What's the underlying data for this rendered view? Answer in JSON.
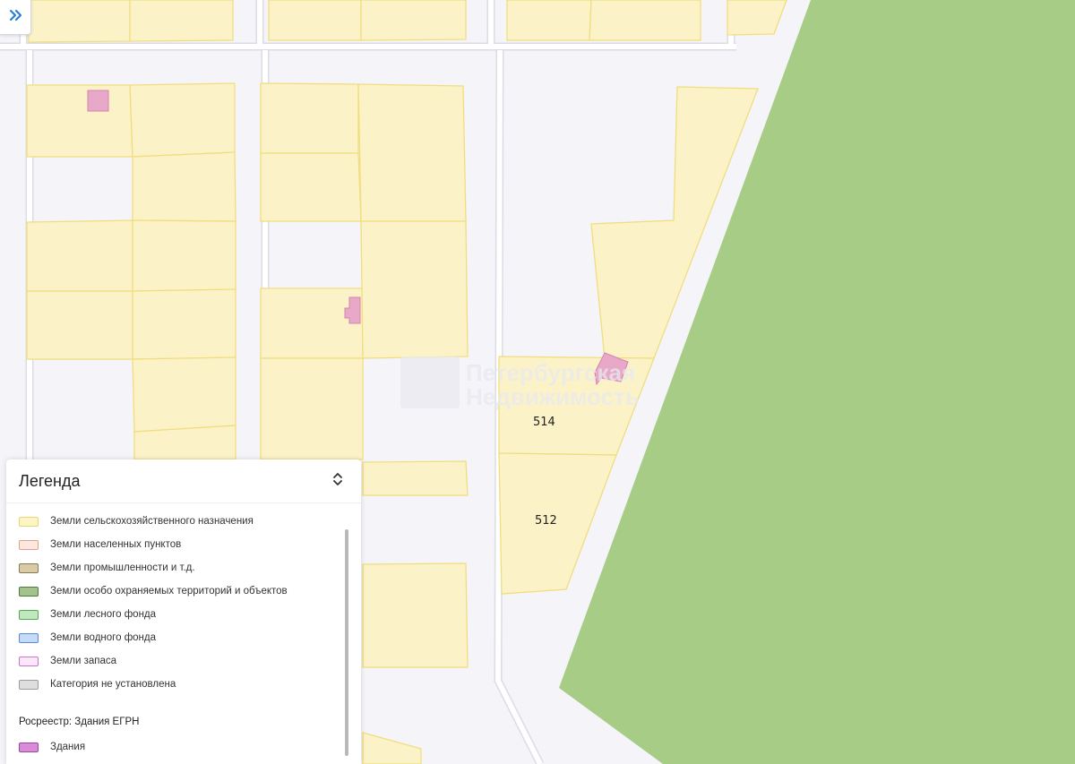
{
  "map": {
    "parcel_labels": [
      "514",
      "512"
    ],
    "watermark": {
      "line1": "Петербургская",
      "line2": "Недвижимость"
    },
    "colors": {
      "parcel_fill": "#fcf2c7",
      "parcel_stroke": "#f0de7e",
      "forest": "#a7cc86",
      "building": "#e8a8c8",
      "road": "#ffffff",
      "background": "#f4f4f9"
    }
  },
  "controls": {
    "expand_icon": "double-chevron-right-icon"
  },
  "legend": {
    "title": "Легенда",
    "collapse_icon": "chevron-up-down-icon",
    "items": [
      {
        "label": "Земли сельскохозяйственного назначения",
        "color": "#fdf4c4",
        "border": "#e8d77a"
      },
      {
        "label": "Земли населенных пунктов",
        "color": "#fde8e0",
        "border": "#e0a090"
      },
      {
        "label": "Земли промышленности и т.д.",
        "color": "#d8cba5",
        "border": "#8a7a52"
      },
      {
        "label": "Земли особо охраняемых территорий и объектов",
        "color": "#a4c28c",
        "border": "#4f7a3a"
      },
      {
        "label": "Земли лесного фонда",
        "color": "#bfe8bf",
        "border": "#5aa65a"
      },
      {
        "label": "Земли водного фонда",
        "color": "#c4daf7",
        "border": "#5a8ad6"
      },
      {
        "label": "Земли запаса",
        "color": "#fbe6fb",
        "border": "#c978c9"
      },
      {
        "label": "Категория не установлена",
        "color": "#dedede",
        "border": "#9c9c9c"
      }
    ],
    "section_title": "Росреестр: Здания ЕГРН",
    "buildings": {
      "label": "Здания",
      "color": "#d98ad8",
      "border": "#a044a0"
    }
  }
}
